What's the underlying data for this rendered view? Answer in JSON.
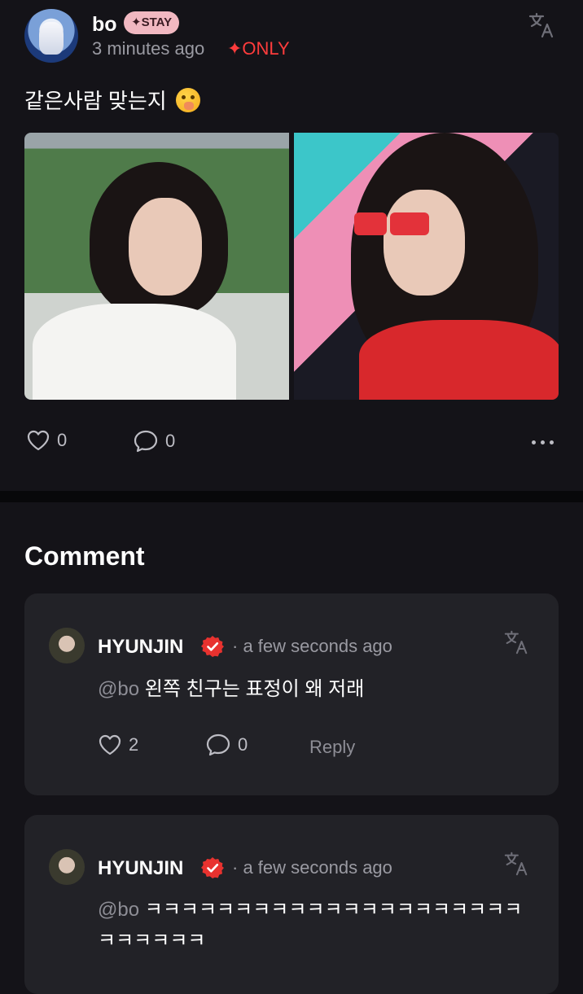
{
  "post": {
    "username": "bo",
    "badge": "✦STAY",
    "time": "3 minutes ago",
    "audience": "✦ONLY",
    "text": "같은사람 맞는지",
    "likes": "0",
    "comments": "0"
  },
  "comments_section": {
    "heading": "Comment",
    "items": [
      {
        "author": "HYUNJIN",
        "time": "· a few seconds ago",
        "mention": "@bo",
        "text": "왼쪽 친구는 표정이 왜 저래",
        "likes": "2",
        "replies": "0",
        "reply_label": "Reply"
      },
      {
        "author": "HYUNJIN",
        "time": "· a few seconds ago",
        "mention": "@bo",
        "text": "ㅋㅋㅋㅋㅋㅋㅋㅋㅋㅋㅋㅋㅋㅋㅋㅋㅋㅋㅋㅋㅋㅋㅋㅋㅋㅋㅋ"
      }
    ]
  },
  "colors": {
    "background": "#141318",
    "card": "#222227",
    "accent_red": "#ff3c3c",
    "badge_pink": "#f1b8c1",
    "muted_text": "#9a9aa2"
  },
  "icons": [
    "translate-icon",
    "heart-icon",
    "comment-bubble-icon",
    "more-dots-icon",
    "verified-badge-icon"
  ]
}
